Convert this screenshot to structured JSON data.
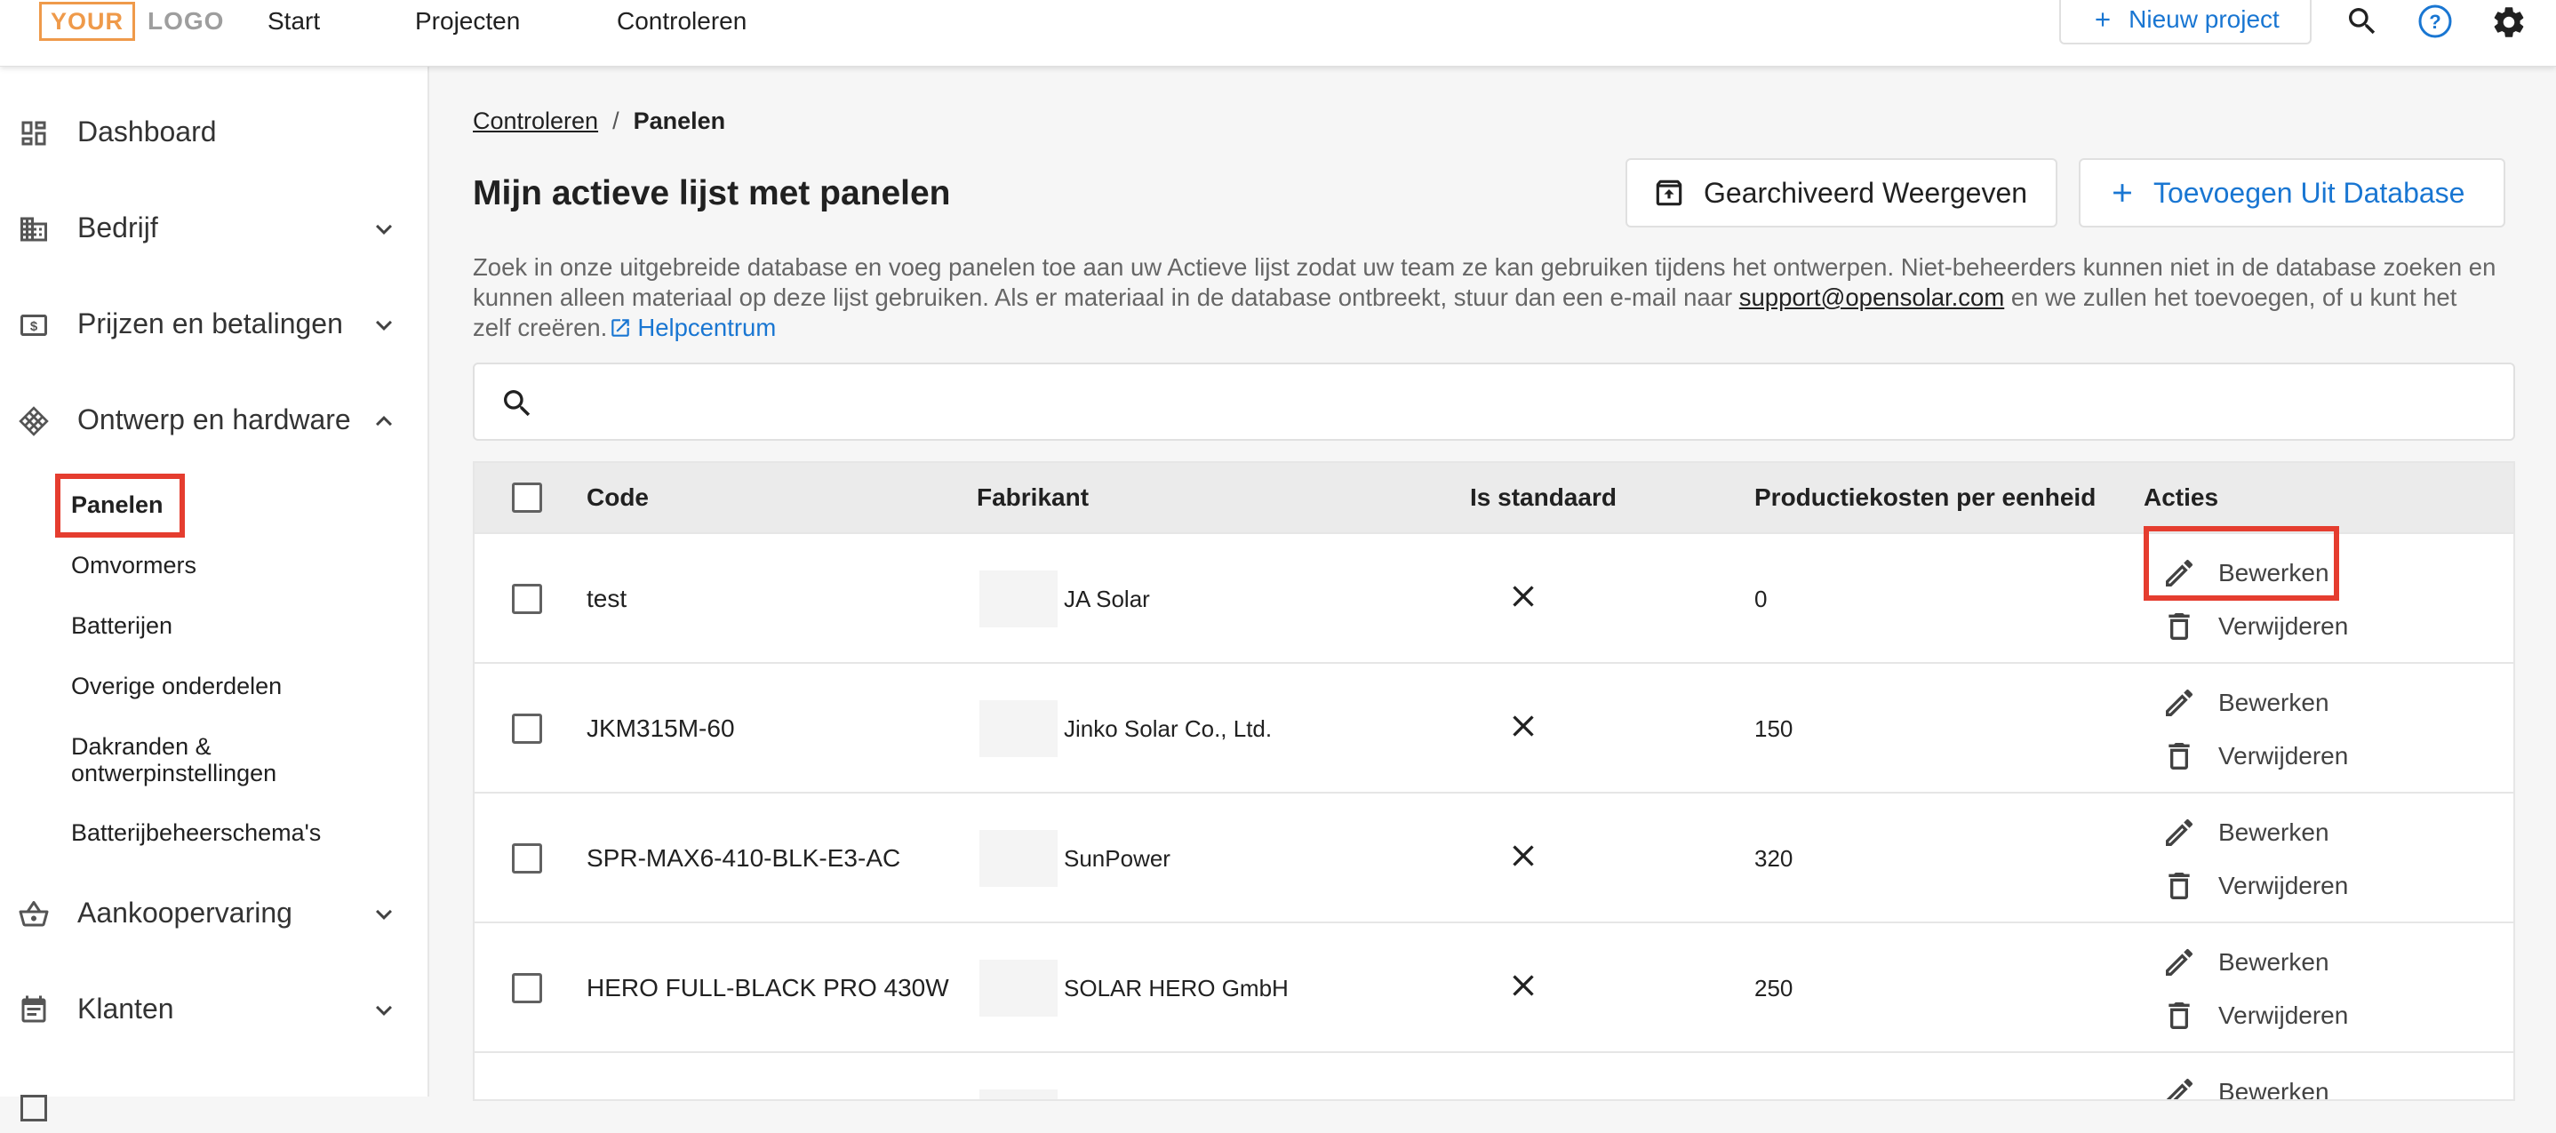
{
  "app": {
    "logo_part1": "YOUR",
    "logo_part2": "LOGO",
    "nav": [
      "Start",
      "Projecten",
      "Controleren"
    ],
    "new_project_label": "Nieuw project",
    "accent_color": "#1976d2",
    "highlight_color": "#e53d2f"
  },
  "sidebar": {
    "items": [
      {
        "label": "Dashboard",
        "icon": "dashboard-icon"
      },
      {
        "label": "Bedrijf",
        "icon": "building-icon"
      },
      {
        "label": "Prijzen en betalingen",
        "icon": "money-icon"
      },
      {
        "label": "Ontwerp en hardware",
        "icon": "grid-pattern-icon"
      },
      {
        "label": "Aankoopervaring",
        "icon": "basket-icon"
      },
      {
        "label": "Klanten",
        "icon": "list-icon"
      }
    ],
    "subitems": [
      "Panelen",
      "Omvormers",
      "Batterijen",
      "Overige onderdelen",
      "Dakranden &",
      "ontwerpinstellingen",
      "Batterijbeheerschema's"
    ]
  },
  "breadcrumb": {
    "parent": "Controleren",
    "separator": "/",
    "current": "Panelen"
  },
  "page": {
    "title": "Mijn actieve lijst met panelen",
    "archived_button": "Gearchiveerd Weergeven",
    "add_button": "Toevoegen Uit Database",
    "description_line1": "Zoek in onze uitgebreide database en voeg panelen toe aan uw Actieve lijst zodat uw team ze kan gebruiken tijdens het ontwerpen. Niet-beheerders kunnen niet in de database zoeken en",
    "description_line2_pre": "kunnen alleen materiaal op deze lijst gebruiken. Als er materiaal in de database ontbreekt, stuur dan een e-mail naar",
    "description_email": "support@opensolar.com",
    "description_line2_post": "en we zullen het toevoegen, of u kunt het",
    "description_line3": "zelf creëren.",
    "help_link": "Helpcentrum"
  },
  "table": {
    "headers": {
      "code": "Code",
      "manufacturer": "Fabrikant",
      "is_default": "Is standaard",
      "cost": "Productiekosten per eenheid",
      "actions": "Acties"
    },
    "edit_label": "Bewerken",
    "delete_label": "Verwijderen",
    "rows": [
      {
        "code": "test",
        "manufacturer": "JA Solar",
        "is_default": "no",
        "cost": "0"
      },
      {
        "code": "JKM315M-60",
        "manufacturer": "Jinko Solar Co., Ltd.",
        "is_default": "no",
        "cost": "150"
      },
      {
        "code": "SPR-MAX6-410-BLK-E3-AC",
        "manufacturer": "SunPower",
        "is_default": "no",
        "cost": "320"
      },
      {
        "code": "HERO FULL-BLACK PRO 430W",
        "manufacturer": "SOLAR HERO GmbH",
        "is_default": "no",
        "cost": "250"
      }
    ]
  }
}
